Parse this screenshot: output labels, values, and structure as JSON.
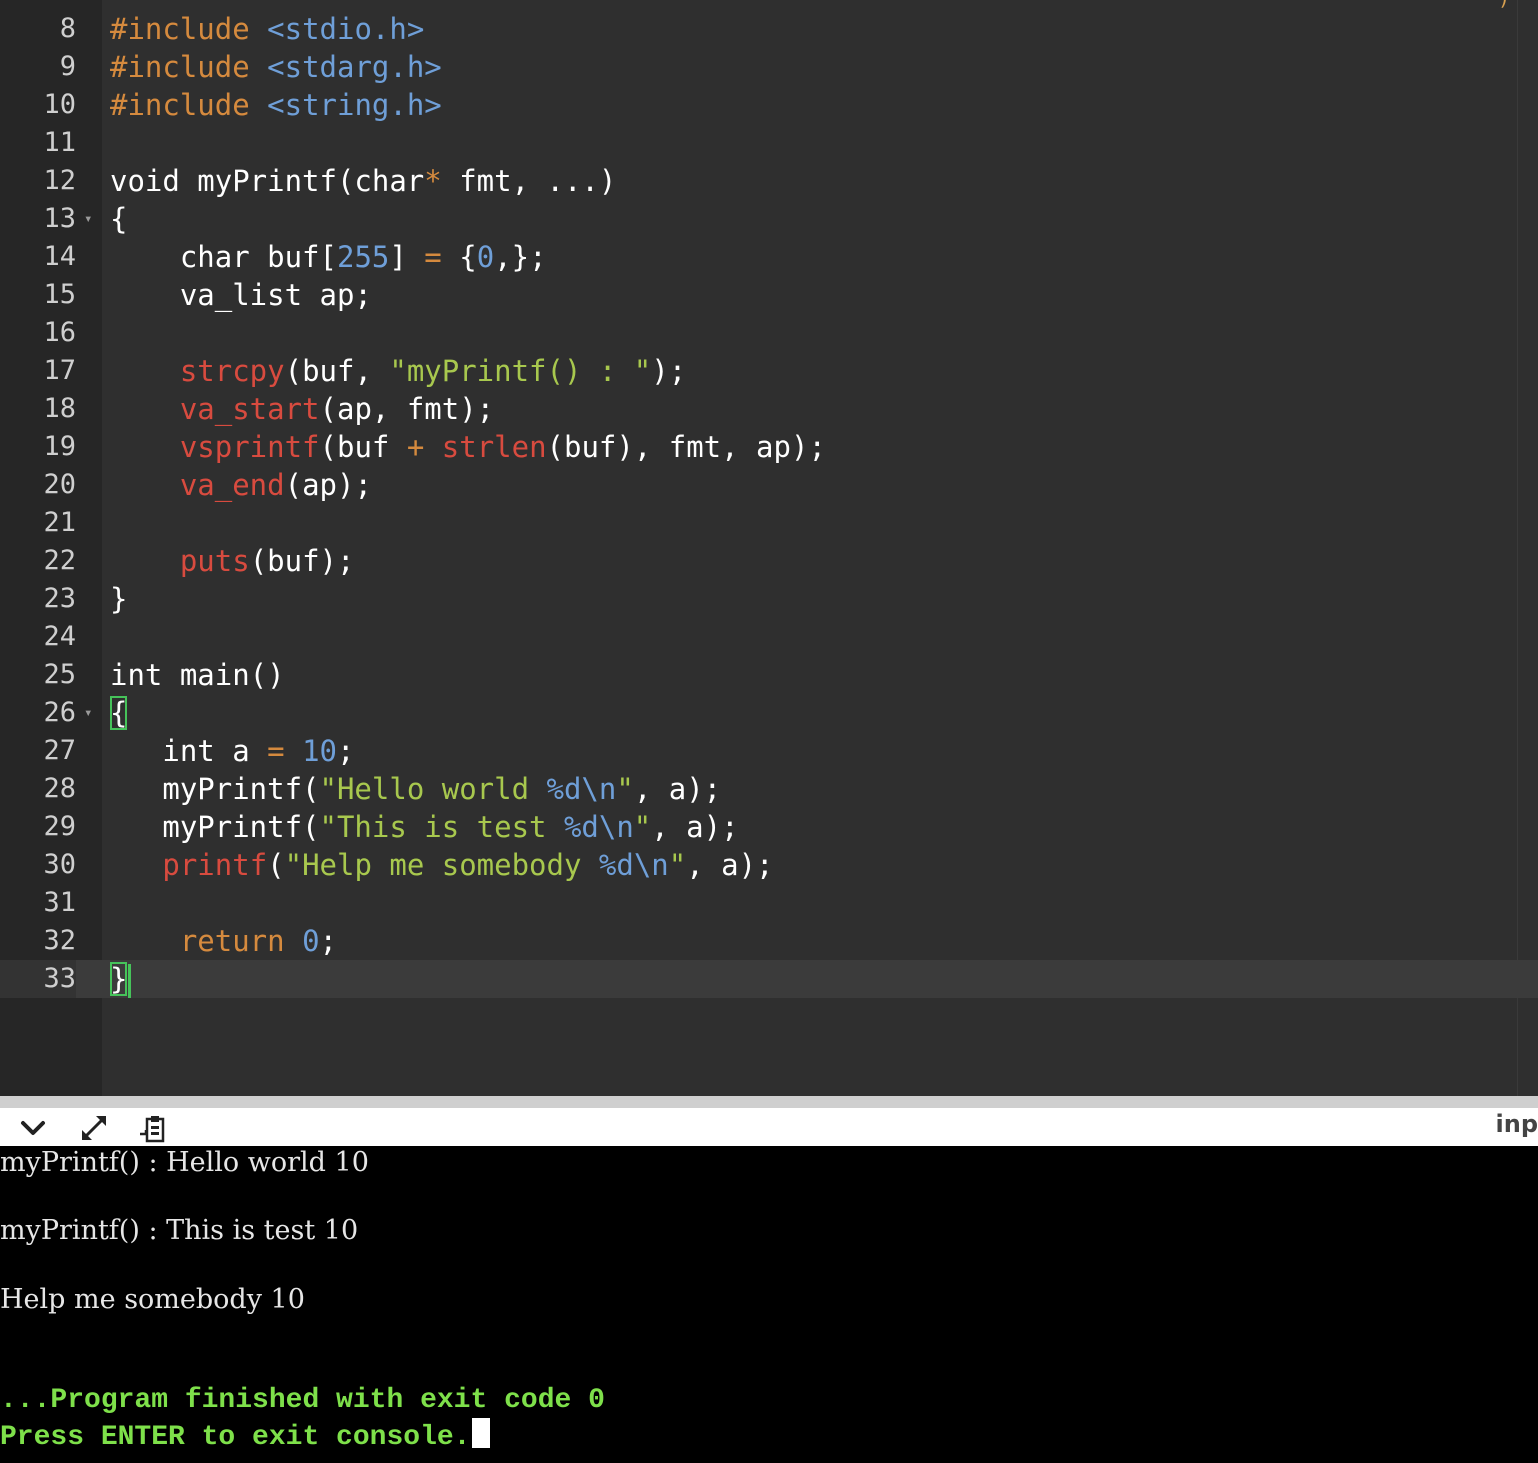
{
  "editor": {
    "lines": [
      {
        "n": "8",
        "fold": false,
        "tokens": [
          {
            "t": "#include",
            "c": "pp"
          },
          {
            "t": " "
          },
          {
            "t": "<stdio.h>",
            "c": "inc"
          }
        ]
      },
      {
        "n": "9",
        "fold": false,
        "tokens": [
          {
            "t": "#include",
            "c": "pp"
          },
          {
            "t": " "
          },
          {
            "t": "<stdarg.h>",
            "c": "inc"
          }
        ]
      },
      {
        "n": "10",
        "fold": false,
        "tokens": [
          {
            "t": "#include",
            "c": "pp"
          },
          {
            "t": " "
          },
          {
            "t": "<string.h>",
            "c": "inc"
          }
        ]
      },
      {
        "n": "11",
        "fold": false,
        "tokens": []
      },
      {
        "n": "12",
        "fold": false,
        "tokens": [
          {
            "t": "void myPrintf(char"
          },
          {
            "t": "*",
            "c": "op"
          },
          {
            "t": " fmt, ...)"
          }
        ]
      },
      {
        "n": "13",
        "fold": true,
        "tokens": [
          {
            "t": "{"
          }
        ]
      },
      {
        "n": "14",
        "fold": false,
        "tokens": [
          {
            "t": "    char buf["
          },
          {
            "t": "255",
            "c": "num"
          },
          {
            "t": "] "
          },
          {
            "t": "=",
            "c": "op"
          },
          {
            "t": " {"
          },
          {
            "t": "0",
            "c": "num"
          },
          {
            "t": ",};"
          }
        ]
      },
      {
        "n": "15",
        "fold": false,
        "tokens": [
          {
            "t": "    va_list ap;"
          }
        ]
      },
      {
        "n": "16",
        "fold": false,
        "tokens": []
      },
      {
        "n": "17",
        "fold": false,
        "tokens": [
          {
            "t": "    "
          },
          {
            "t": "strcpy",
            "c": "fn"
          },
          {
            "t": "(buf, "
          },
          {
            "t": "\"myPrintf() : \"",
            "c": "str"
          },
          {
            "t": ");"
          }
        ]
      },
      {
        "n": "18",
        "fold": false,
        "tokens": [
          {
            "t": "    "
          },
          {
            "t": "va_start",
            "c": "fn"
          },
          {
            "t": "(ap, fmt);"
          }
        ]
      },
      {
        "n": "19",
        "fold": false,
        "tokens": [
          {
            "t": "    "
          },
          {
            "t": "vsprintf",
            "c": "fn"
          },
          {
            "t": "(buf "
          },
          {
            "t": "+",
            "c": "op"
          },
          {
            "t": " "
          },
          {
            "t": "strlen",
            "c": "fn"
          },
          {
            "t": "(buf), fmt, ap);"
          }
        ]
      },
      {
        "n": "20",
        "fold": false,
        "tokens": [
          {
            "t": "    "
          },
          {
            "t": "va_end",
            "c": "fn"
          },
          {
            "t": "(ap);"
          }
        ]
      },
      {
        "n": "21",
        "fold": false,
        "tokens": []
      },
      {
        "n": "22",
        "fold": false,
        "tokens": [
          {
            "t": "    "
          },
          {
            "t": "puts",
            "c": "fn"
          },
          {
            "t": "(buf);"
          }
        ]
      },
      {
        "n": "23",
        "fold": false,
        "tokens": [
          {
            "t": "}"
          }
        ]
      },
      {
        "n": "24",
        "fold": false,
        "tokens": []
      },
      {
        "n": "25",
        "fold": false,
        "tokens": [
          {
            "t": "int main()"
          }
        ]
      },
      {
        "n": "26",
        "fold": true,
        "tokens": [
          {
            "t": "{",
            "c": "match"
          }
        ]
      },
      {
        "n": "27",
        "fold": false,
        "tokens": [
          {
            "t": "   int a "
          },
          {
            "t": "=",
            "c": "op"
          },
          {
            "t": " "
          },
          {
            "t": "10",
            "c": "num"
          },
          {
            "t": ";"
          }
        ]
      },
      {
        "n": "28",
        "fold": false,
        "tokens": [
          {
            "t": "   myPrintf("
          },
          {
            "t": "\"Hello world ",
            "c": "str"
          },
          {
            "t": "%d\\n",
            "c": "esc"
          },
          {
            "t": "\"",
            "c": "str"
          },
          {
            "t": ", a);"
          }
        ]
      },
      {
        "n": "29",
        "fold": false,
        "tokens": [
          {
            "t": "   myPrintf("
          },
          {
            "t": "\"This is test ",
            "c": "str"
          },
          {
            "t": "%d\\n",
            "c": "esc"
          },
          {
            "t": "\"",
            "c": "str"
          },
          {
            "t": ", a);"
          }
        ]
      },
      {
        "n": "30",
        "fold": false,
        "tokens": [
          {
            "t": "   "
          },
          {
            "t": "printf",
            "c": "fn"
          },
          {
            "t": "("
          },
          {
            "t": "\"Help me somebody ",
            "c": "str"
          },
          {
            "t": "%d\\n",
            "c": "esc"
          },
          {
            "t": "\"",
            "c": "str"
          },
          {
            "t": ", a);"
          }
        ]
      },
      {
        "n": "31",
        "fold": false,
        "tokens": []
      },
      {
        "n": "32",
        "fold": false,
        "tokens": [
          {
            "t": "    "
          },
          {
            "t": "return",
            "c": "kw"
          },
          {
            "t": " "
          },
          {
            "t": "0",
            "c": "num"
          },
          {
            "t": ";"
          }
        ]
      },
      {
        "n": "33",
        "fold": false,
        "active": true,
        "tokens": [
          {
            "t": "}",
            "c": "match"
          },
          {
            "t": "",
            "c": "caret"
          }
        ]
      }
    ]
  },
  "console_toolbar": {
    "collapse_icon": "chevron-down-icon",
    "maximize_icon": "expand-arrows-icon",
    "copy_icon": "clipboard-icon",
    "input_tab_label": "inp"
  },
  "console": {
    "output_lines": [
      "myPrintf() : Hello world 10",
      "myPrintf() : This is test 10",
      "Help me somebody 10"
    ],
    "finished_message": "...Program finished with exit code 0",
    "prompt_message": "Press ENTER to exit console."
  },
  "colors": {
    "editor_bg": "#2f2f2f",
    "gutter_bg": "#262626",
    "preprocessor": "#d58a3e",
    "include_path": "#6f9fd8",
    "function": "#d84b3f",
    "string": "#a8c84e",
    "number": "#6f9fd8",
    "bracket_match": "#46c35a",
    "console_bg": "#000000",
    "console_done": "#7ee04a"
  }
}
